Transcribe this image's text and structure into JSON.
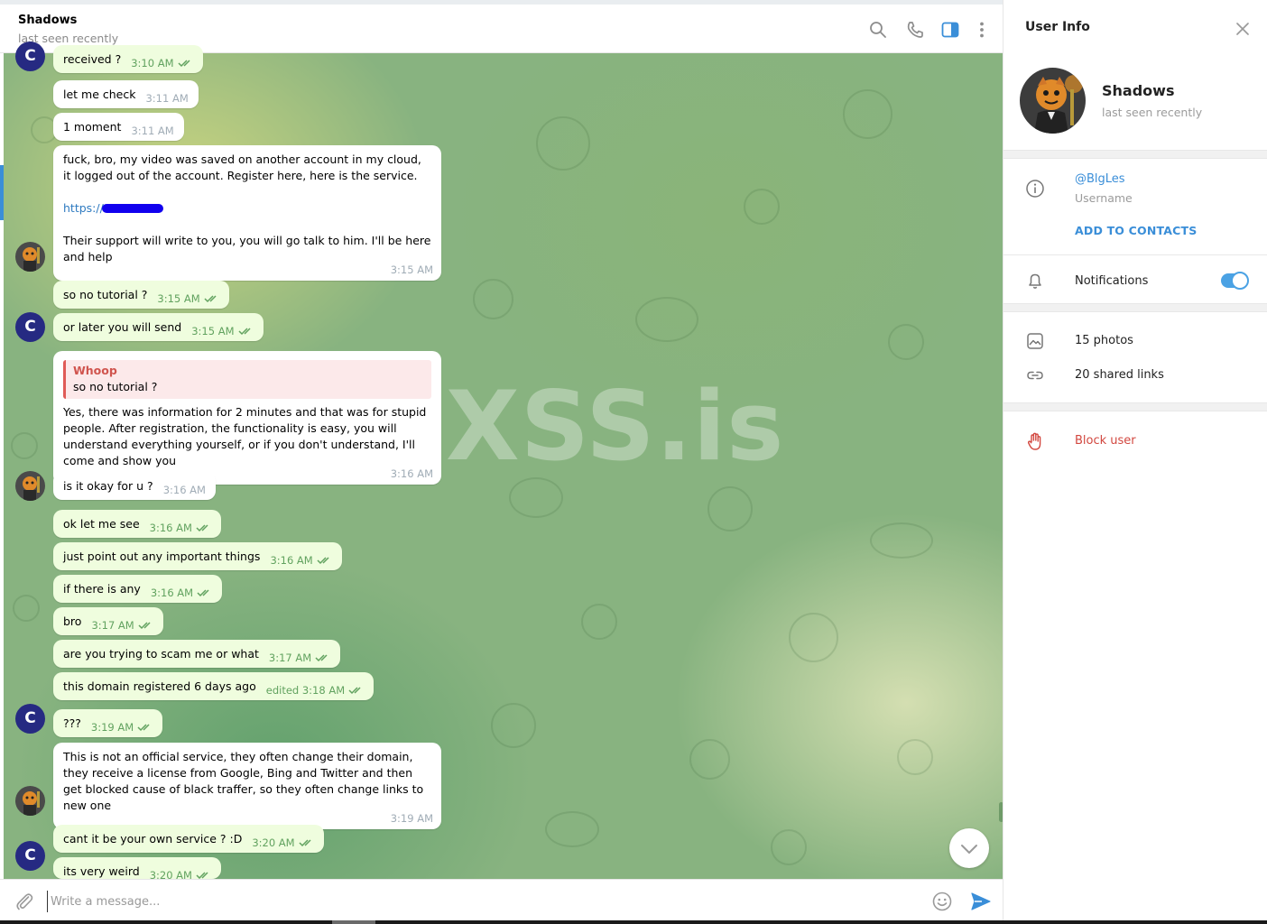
{
  "header": {
    "title": "Shadows",
    "status": "last seen recently"
  },
  "watermark": "XSS.is",
  "messages": [
    {
      "text": "received ?",
      "time": "3:10 AM",
      "dir": "out"
    },
    {
      "text": "let me check",
      "time": "3:11 AM",
      "dir": "in"
    },
    {
      "text": "1 moment",
      "time": "3:11 AM",
      "dir": "in"
    },
    {
      "line1": "fuck, bro, my video was saved on another account in my cloud, it logged out of the account. Register here, here is the service.",
      "link": "https://",
      "line2": "Their support will write to you, you will go talk to him. I'll be here and help",
      "time": "3:15 AM",
      "dir": "in"
    },
    {
      "text": "so no tutorial ?",
      "time": "3:15 AM",
      "dir": "out"
    },
    {
      "text": "or later you will send",
      "time": "3:15 AM",
      "dir": "out"
    },
    {
      "quote_name": "Whoop",
      "quote_text": "so no tutorial ?",
      "text": "Yes, there was information for 2 minutes and that was for stupid people. After registration, the functionality is easy, you will understand everything yourself, or if you don't understand, I'll come and show you",
      "time": "3:16 AM",
      "dir": "in"
    },
    {
      "text": "is it okay for u ?",
      "time": "3:16 AM",
      "dir": "in"
    },
    {
      "text": "ok let me see",
      "time": "3:16 AM",
      "dir": "out"
    },
    {
      "text": "just point out any important things",
      "time": "3:16 AM",
      "dir": "out"
    },
    {
      "text": "if there is any",
      "time": "3:16 AM",
      "dir": "out"
    },
    {
      "text": "bro",
      "time": "3:17 AM",
      "dir": "out"
    },
    {
      "text": "are you trying to scam me or what",
      "time": "3:17 AM",
      "dir": "out"
    },
    {
      "text": "this domain registered 6 days ago",
      "time": "edited 3:18 AM",
      "dir": "out"
    },
    {
      "text": "???",
      "time": "3:19 AM",
      "dir": "out"
    },
    {
      "text": "This is not an official service, they often change their domain, they receive a license from Google, Bing and Twitter and then get blocked cause of black traffer, so they often change links to new one",
      "time": "3:19 AM",
      "dir": "in"
    },
    {
      "text": "cant it be your own service ? :D",
      "time": "3:20 AM",
      "dir": "out"
    },
    {
      "text": "its very weird",
      "time": "3:20 AM",
      "dir": "out"
    }
  ],
  "avatars": {
    "self_letter": "C"
  },
  "composer": {
    "placeholder": "Write a message..."
  },
  "panel": {
    "title": "User Info",
    "name": "Shadows",
    "status": "last seen recently",
    "username": "@BlgLes",
    "username_label": "Username",
    "add_contacts": "ADD TO CONTACTS",
    "notifications": "Notifications",
    "notifications_on": true,
    "photos": "15 photos",
    "shared_links": "20 shared links",
    "block": "Block user"
  },
  "colors": {
    "accent": "#3a8ed8",
    "outgoing_bubble": "#effdde",
    "danger": "#d2473f",
    "tick": "#61a25f"
  },
  "icons": [
    "search-icon",
    "phone-icon",
    "sidebar-toggle-icon",
    "more-vertical-icon",
    "close-icon",
    "info-icon",
    "bell-icon",
    "photo-icon",
    "link-icon",
    "hand-icon",
    "attach-icon",
    "emoji-icon",
    "send-icon",
    "chevron-down-icon"
  ]
}
